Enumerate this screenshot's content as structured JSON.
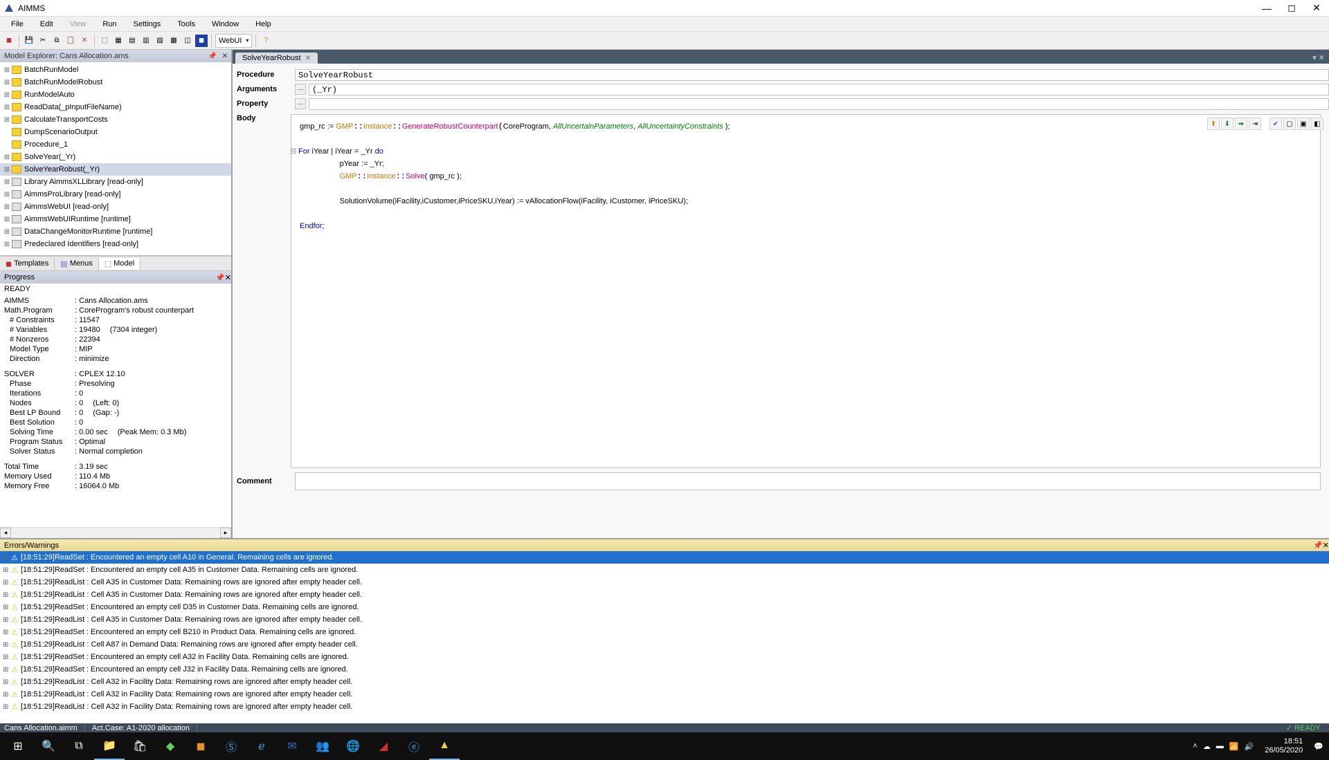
{
  "window": {
    "title": "AIMMS"
  },
  "menubar": [
    "File",
    "Edit",
    "View",
    "Run",
    "Settings",
    "Tools",
    "Window",
    "Help"
  ],
  "toolbar": {
    "webui": "WebUI"
  },
  "model_explorer": {
    "title": "Model Explorer: Cans Allocation.ams",
    "items": [
      {
        "label": "BatchRunModel",
        "type": "proc",
        "exp": "+"
      },
      {
        "label": "BatchRunModelRobust",
        "type": "proc",
        "exp": "+"
      },
      {
        "label": "RunModelAuto",
        "type": "proc",
        "exp": "+"
      },
      {
        "label": "ReadData(_pInputFileName)",
        "type": "proc",
        "exp": "+"
      },
      {
        "label": "CalculateTransportCosts",
        "type": "proc",
        "exp": "+"
      },
      {
        "label": "DumpScenarioOutput",
        "type": "proc",
        "exp": ""
      },
      {
        "label": "Procedure_1",
        "type": "proc",
        "exp": ""
      },
      {
        "label": "SolveYear(_Yr)",
        "type": "proc",
        "exp": "+"
      },
      {
        "label": "SolveYearRobust(_Yr)",
        "type": "proc",
        "exp": "+",
        "selected": true
      },
      {
        "label": "Library AimmsXLLibrary [read-only]",
        "type": "lib",
        "exp": "+"
      },
      {
        "label": "AimmsProLibrary [read-only]",
        "type": "lib",
        "exp": "+"
      },
      {
        "label": "AimmsWebUI [read-only]",
        "type": "lib",
        "exp": "+"
      },
      {
        "label": "AimmsWebUIRuntime [runtime]",
        "type": "lib",
        "exp": "+"
      },
      {
        "label": "DataChangeMonitorRuntime [runtime]",
        "type": "lib",
        "exp": "+"
      },
      {
        "label": "Predeclared Identifiers [read-only]",
        "type": "lib",
        "exp": "+"
      }
    ],
    "tabs": {
      "templates": "Templates",
      "menus": "Menus",
      "model": "Model"
    }
  },
  "progress": {
    "title": "Progress",
    "ready": "READY",
    "rows": [
      {
        "label": "AIMMS",
        "val": "Cans Allocation.ams",
        "top": true
      },
      {
        "label": "Math.Program",
        "val": "CoreProgram's robust counterpart",
        "top": true
      },
      {
        "label": "# Constraints",
        "val": "11547"
      },
      {
        "label": "# Variables",
        "val": "19480",
        "extra": "(7304 integer)"
      },
      {
        "label": "# Nonzeros",
        "val": "22394"
      },
      {
        "label": "Model Type",
        "val": "MIP"
      },
      {
        "label": "Direction",
        "val": "minimize"
      }
    ],
    "solver_section": [
      {
        "label": "SOLVER",
        "val": "CPLEX 12.10",
        "top": true
      },
      {
        "label": "Phase",
        "val": "Presolving"
      },
      {
        "label": "Iterations",
        "val": "0"
      },
      {
        "label": "Nodes",
        "val": "0",
        "extra": "(Left: 0)"
      },
      {
        "label": "Best LP Bound",
        "val": "0",
        "extra": "(Gap: -)"
      },
      {
        "label": "Best Solution",
        "val": "0"
      },
      {
        "label": "Solving Time",
        "val": "0.00 sec",
        "extra": "(Peak Mem: 0.3 Mb)"
      },
      {
        "label": "Program Status",
        "val": "Optimal"
      },
      {
        "label": "Solver Status",
        "val": "Normal completion"
      }
    ],
    "totals": [
      {
        "label": "Total Time",
        "val": "3.19 sec",
        "top": true
      },
      {
        "label": "Memory Used",
        "val": "110.4 Mb",
        "top": true
      },
      {
        "label": "Memory Free",
        "val": "16064.0 Mb",
        "top": true
      }
    ]
  },
  "editor": {
    "tab": "SolveYearRobust",
    "procedure_label": "Procedure",
    "procedure_value": "SolveYearRobust",
    "arguments_label": "Arguments",
    "arguments_value": "(_Yr)",
    "property_label": "Property",
    "body_label": "Body",
    "comment_label": "Comment",
    "code": {
      "l1_pre": "gmp_rc := ",
      "l1_ns": "GMP",
      "l1_ns2": "Instance",
      "l1_fn": "GenerateRobustCounterpart",
      "l1_arg1": "CoreProgram, ",
      "l1_id1": "AllUncertainParameters",
      "l1_sep": ", ",
      "l1_id2": "AllUncertaintyConstraints",
      "l1_end": " );",
      "l2_kw": "For",
      "l2_body": " iYear | iYear = _Yr ",
      "l2_kw2": "do",
      "l3": "pYear := _Yr;",
      "l4_ns": "GMP",
      "l4_ns2": "Instance",
      "l4_fn": "Solve",
      "l4_args": "( gmp_rc );",
      "l5": "SolutionVolume(iFacility,iCustomer,iPriceSKU,iYear) := vAllocationFlow(iFacility, iCustomer, iPriceSKU);",
      "l6_kw": "Endfor",
      "l6_end": ";"
    }
  },
  "errors": {
    "title": "Errors/Warnings",
    "rows": [
      {
        "ts": "[18:51:29]",
        "msg": "ReadSet : Encountered an empty cell A10 in General. Remaining cells are ignored.",
        "selected": true
      },
      {
        "ts": "[18:51:29]",
        "msg": "ReadSet : Encountered an empty cell A35 in Customer Data. Remaining cells are ignored."
      },
      {
        "ts": "[18:51:29]",
        "msg": "ReadList : Cell A35 in Customer Data: Remaining rows are ignored after empty header cell."
      },
      {
        "ts": "[18:51:29]",
        "msg": "ReadList : Cell A35 in Customer Data: Remaining rows are ignored after empty header cell."
      },
      {
        "ts": "[18:51:29]",
        "msg": "ReadSet : Encountered an empty cell D35 in Customer Data. Remaining cells are ignored."
      },
      {
        "ts": "[18:51:29]",
        "msg": "ReadList : Cell A35 in Customer Data: Remaining rows are ignored after empty header cell."
      },
      {
        "ts": "[18:51:29]",
        "msg": "ReadSet : Encountered an empty cell B210 in Product Data. Remaining cells are ignored."
      },
      {
        "ts": "[18:51:29]",
        "msg": "ReadList : Cell A87 in Demand Data: Remaining rows are ignored after empty header cell."
      },
      {
        "ts": "[18:51:29]",
        "msg": "ReadSet : Encountered an empty cell A32 in Facility Data. Remaining cells are ignored."
      },
      {
        "ts": "[18:51:29]",
        "msg": "ReadSet : Encountered an empty cell J32 in Facility Data. Remaining cells are ignored."
      },
      {
        "ts": "[18:51:29]",
        "msg": "ReadList : Cell A32 in Facility Data: Remaining rows are ignored after empty header cell."
      },
      {
        "ts": "[18:51:29]",
        "msg": "ReadList : Cell A32 in Facility Data: Remaining rows are ignored after empty header cell."
      },
      {
        "ts": "[18:51:29]",
        "msg": "ReadList : Cell A32 in Facility Data: Remaining rows are ignored after empty header cell."
      }
    ]
  },
  "statusbar": {
    "file": "Cans Allocation.aimm",
    "case": "Act.Case: A1-2020 allocation",
    "ready": "READY"
  },
  "taskbar": {
    "time": "18:51",
    "date": "26/05/2020"
  }
}
